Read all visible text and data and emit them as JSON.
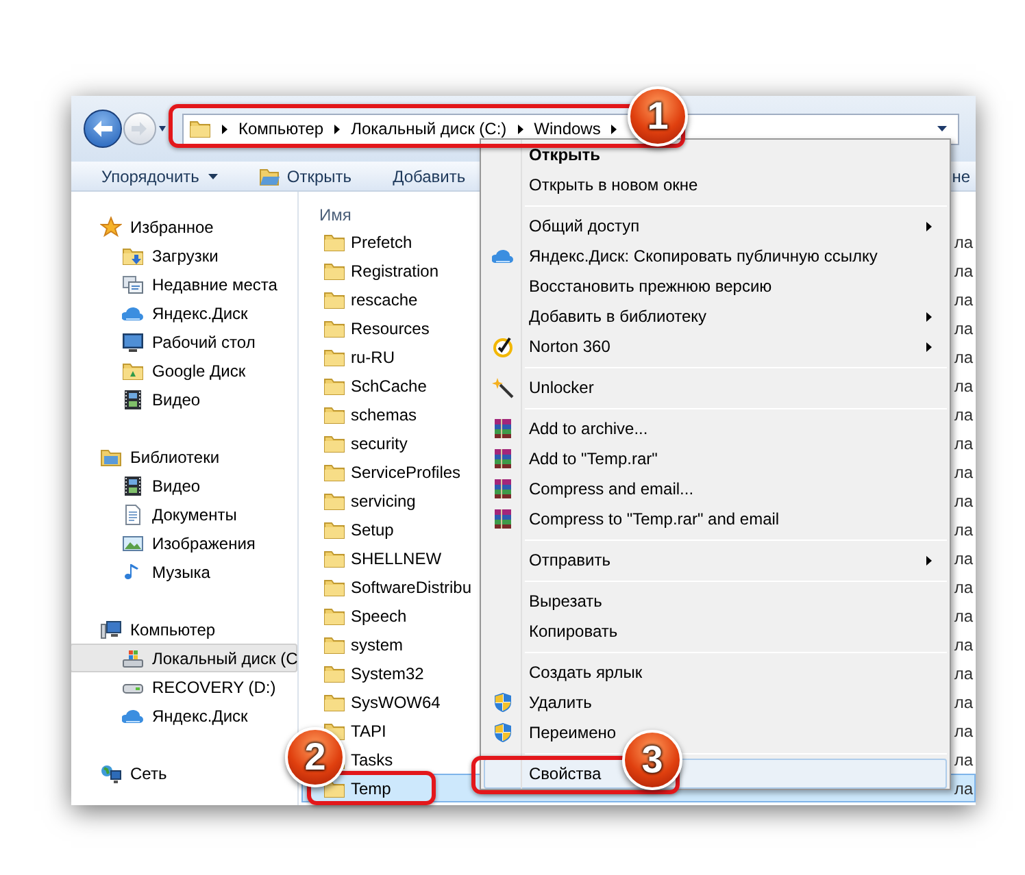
{
  "address_bar": {
    "crumbs": [
      "Компьютер",
      "Локальный диск (C:)",
      "Windows"
    ]
  },
  "toolbar": [
    {
      "label": "Упорядочить",
      "kind": "menu"
    },
    {
      "label": "Открыть",
      "kind": "open"
    },
    {
      "label": "Добавить",
      "kind": "plain"
    },
    {
      "label": "не",
      "kind": "plain"
    }
  ],
  "sidebar": {
    "groups": [
      {
        "label": "Избранное",
        "kind": "star",
        "children": [
          {
            "label": "Загрузки",
            "kind": "downloads",
            "selected": false
          },
          {
            "label": "Недавние места",
            "kind": "recent",
            "selected": false
          },
          {
            "label": "Яндекс.Диск",
            "kind": "cloud",
            "selected": false
          },
          {
            "label": "Рабочий стол",
            "kind": "desktop",
            "selected": false
          },
          {
            "label": "Google Диск",
            "kind": "gdrive",
            "selected": false
          },
          {
            "label": "Видео",
            "kind": "video",
            "selected": false
          }
        ]
      },
      {
        "label": "Библиотеки",
        "kind": "library",
        "children": [
          {
            "label": "Видео",
            "kind": "video",
            "selected": false
          },
          {
            "label": "Документы",
            "kind": "document",
            "selected": false
          },
          {
            "label": "Изображения",
            "kind": "image",
            "selected": false
          },
          {
            "label": "Музыка",
            "kind": "music",
            "selected": false
          }
        ]
      },
      {
        "label": "Компьютер",
        "kind": "computer",
        "children": [
          {
            "label": "Локальный диск (С",
            "kind": "disk",
            "selected": true
          },
          {
            "label": "RECOVERY (D:)",
            "kind": "drive",
            "selected": false
          },
          {
            "label": "Яндекс.Диск",
            "kind": "cloud",
            "selected": false
          }
        ]
      },
      {
        "label": "Сеть",
        "kind": "network"
      }
    ]
  },
  "file_list": {
    "columns": [
      "Имя"
    ],
    "rows": [
      {
        "name": "Prefetch",
        "column_3": "ла",
        "selected": false
      },
      {
        "name": "Registration",
        "column_3": "ла",
        "selected": false
      },
      {
        "name": "rescache",
        "column_3": "ла",
        "selected": false
      },
      {
        "name": "Resources",
        "column_3": "ла",
        "selected": false
      },
      {
        "name": "ru-RU",
        "column_3": "ла",
        "selected": false
      },
      {
        "name": "SchCache",
        "column_3": "ла",
        "selected": false
      },
      {
        "name": "schemas",
        "column_3": "ла",
        "selected": false
      },
      {
        "name": "security",
        "column_3": "ла",
        "selected": false
      },
      {
        "name": "ServiceProfiles",
        "column_3": "ла",
        "selected": false
      },
      {
        "name": "servicing",
        "column_3": "ла",
        "selected": false
      },
      {
        "name": "Setup",
        "column_3": "ла",
        "selected": false
      },
      {
        "name": "SHELLNEW",
        "column_3": "ла",
        "selected": false
      },
      {
        "name": "SoftwareDistribu",
        "column_3": "ла",
        "selected": false
      },
      {
        "name": "Speech",
        "column_3": "ла",
        "selected": false
      },
      {
        "name": "system",
        "column_3": "ла",
        "selected": false
      },
      {
        "name": "System32",
        "column_3": "ла",
        "selected": false
      },
      {
        "name": "SysWOW64",
        "column_3": "ла",
        "selected": false
      },
      {
        "name": "TAPI",
        "column_3": "ла",
        "selected": false
      },
      {
        "name": "Tasks",
        "column_3": "ла",
        "selected": false
      },
      {
        "name": "Temp",
        "column_3": "ла",
        "selected": true
      }
    ]
  },
  "context_menu": [
    {
      "kind": "plain",
      "label": "Открыть",
      "default": true,
      "submenu": false,
      "selected": false
    },
    {
      "kind": "plain",
      "label": "Открыть в новом окне",
      "default": false,
      "submenu": false,
      "selected": false
    },
    {
      "kind": "separator"
    },
    {
      "kind": "plain",
      "label": "Общий доступ",
      "default": false,
      "submenu": true,
      "selected": false
    },
    {
      "kind": "cloud",
      "label": "Яндекс.Диск: Скопировать публичную ссылку",
      "default": false,
      "submenu": false,
      "selected": false
    },
    {
      "kind": "plain",
      "label": "Восстановить прежнюю версию",
      "default": false,
      "submenu": false,
      "selected": false
    },
    {
      "kind": "plain",
      "label": "Добавить в библиотеку",
      "default": false,
      "submenu": true,
      "selected": false
    },
    {
      "kind": "norton",
      "label": "Norton 360",
      "default": false,
      "submenu": true,
      "selected": false
    },
    {
      "kind": "separator"
    },
    {
      "kind": "wand",
      "label": "Unlocker",
      "default": false,
      "submenu": false,
      "selected": false
    },
    {
      "kind": "separator"
    },
    {
      "kind": "rar",
      "label": "Add to archive...",
      "default": false,
      "submenu": false,
      "selected": false
    },
    {
      "kind": "rar",
      "label": "Add to \"Temp.rar\"",
      "default": false,
      "submenu": false,
      "selected": false
    },
    {
      "kind": "rar",
      "label": "Compress and email...",
      "default": false,
      "submenu": false,
      "selected": false
    },
    {
      "kind": "rar",
      "label": "Compress to \"Temp.rar\" and email",
      "default": false,
      "submenu": false,
      "selected": false
    },
    {
      "kind": "separator"
    },
    {
      "kind": "plain",
      "label": "Отправить",
      "default": false,
      "submenu": true,
      "selected": false
    },
    {
      "kind": "separator"
    },
    {
      "kind": "plain",
      "label": "Вырезать",
      "default": false,
      "submenu": false,
      "selected": false
    },
    {
      "kind": "plain",
      "label": "Копировать",
      "default": false,
      "submenu": false,
      "selected": false
    },
    {
      "kind": "separator"
    },
    {
      "kind": "plain",
      "label": "Создать ярлык",
      "default": false,
      "submenu": false,
      "selected": false
    },
    {
      "kind": "shield",
      "label": "Удалить",
      "default": false,
      "submenu": false,
      "selected": false
    },
    {
      "kind": "shield",
      "label": "Переимено",
      "default": false,
      "submenu": false,
      "selected": false
    },
    {
      "kind": "separator"
    },
    {
      "kind": "plain",
      "label": "Свойства",
      "default": false,
      "submenu": false,
      "selected": true
    }
  ],
  "callouts": [
    {
      "label": "1"
    },
    {
      "label": "2"
    },
    {
      "label": "3"
    }
  ]
}
